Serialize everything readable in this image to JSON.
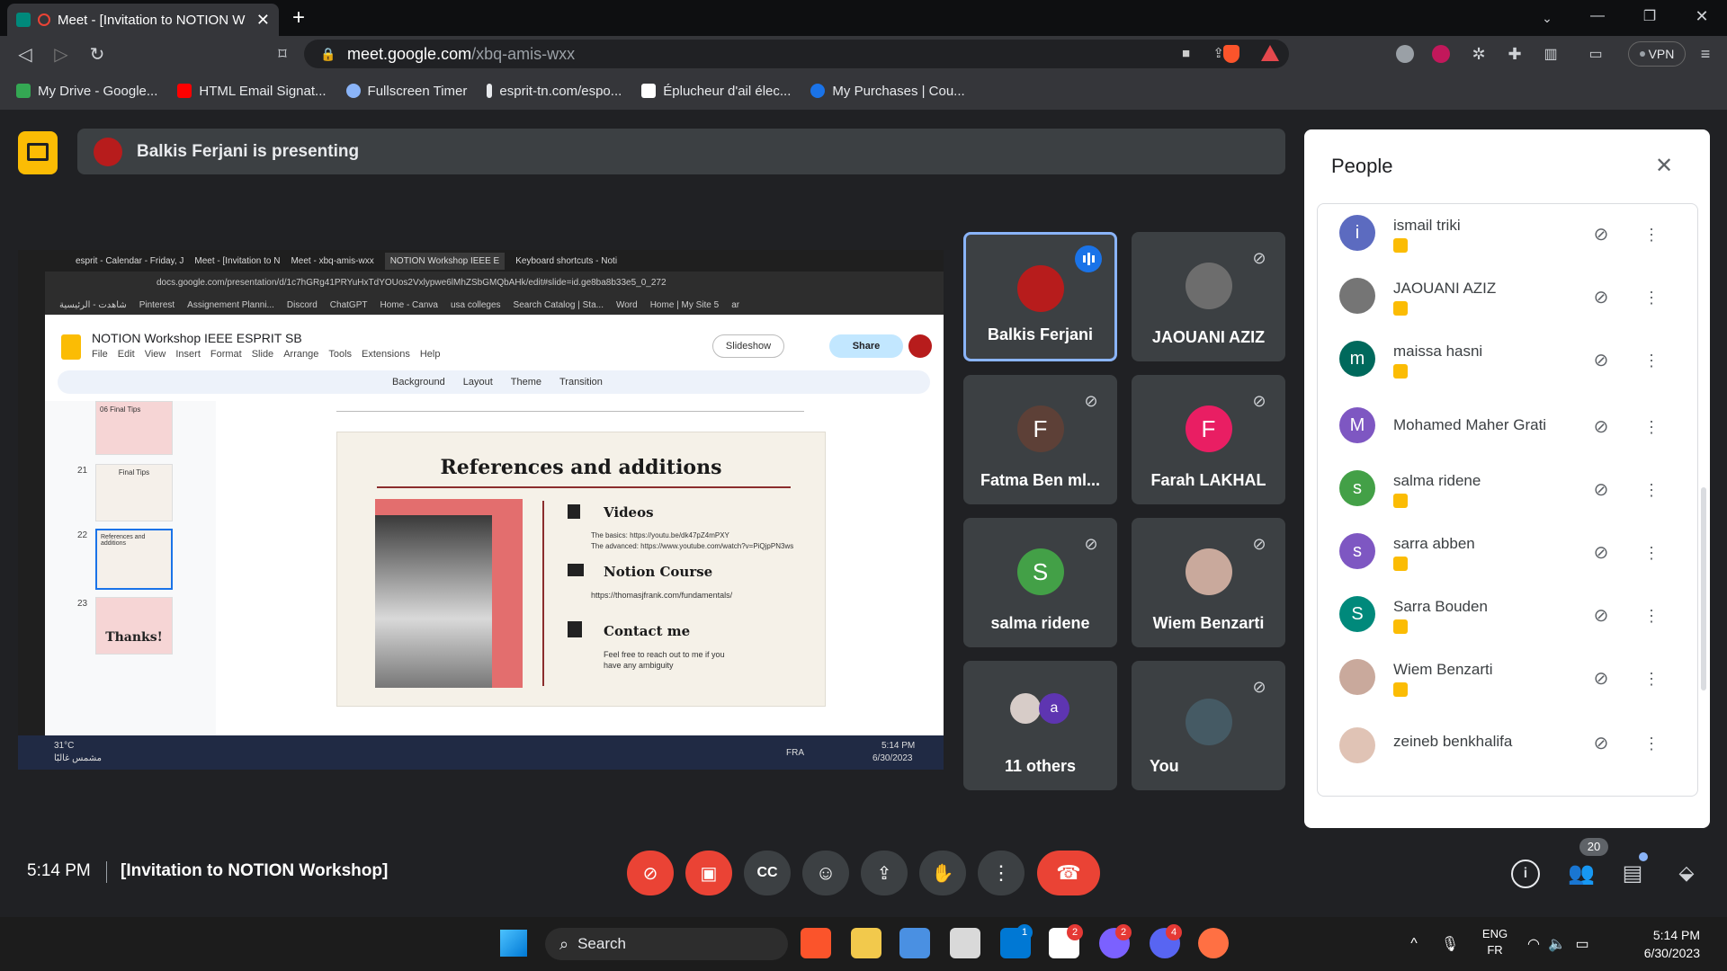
{
  "browser": {
    "tab_title": "Meet - [Invitation to NOTION W",
    "url_domain": "meet.google.com",
    "url_path": "/xbq-amis-wxx",
    "vpn_label": "VPN",
    "bookmarks": [
      {
        "label": "My Drive - Google...",
        "color": "#34a853"
      },
      {
        "label": "HTML Email Signat...",
        "color": "#ff0000"
      },
      {
        "label": "Fullscreen Timer",
        "color": "#8ab4f8"
      },
      {
        "label": "esprit-tn.com/espo...",
        "color": "#e8eaed"
      },
      {
        "label": "Éplucheur d'ail élec...",
        "color": "#ffffff"
      },
      {
        "label": "My Purchases | Cou...",
        "color": "#1a73e8"
      }
    ]
  },
  "meet": {
    "presenting_text": "Balkis Ferjani is presenting",
    "meeting_time": "5:14 PM",
    "meeting_title": "[Invitation to NOTION Workshop]",
    "participant_count": "20",
    "tiles": [
      {
        "name": "Balkis Ferjani",
        "initial": "",
        "color": "#b71c1c",
        "speaking": true
      },
      {
        "name": "JAOUANI AZIZ",
        "initial": "",
        "color": "#6d6d6d",
        "speaking": false
      },
      {
        "name": "Fatma Ben ml...",
        "initial": "F",
        "color": "#5d4037",
        "speaking": false
      },
      {
        "name": "Farah LAKHAL",
        "initial": "F",
        "color": "#e91e63",
        "speaking": false
      },
      {
        "name": "salma ridene",
        "initial": "S",
        "color": "#43a047",
        "speaking": false
      },
      {
        "name": "Wiem Benzarti",
        "initial": "",
        "color": "#c9a99c",
        "speaking": false
      },
      {
        "name": "11 others",
        "initial": "a",
        "color": "#5e35b1",
        "speaking": false
      },
      {
        "name": "You",
        "initial": "",
        "color": "#455a64",
        "speaking": false
      }
    ]
  },
  "people_panel": {
    "title": "People",
    "participants": [
      {
        "name": "ismail triki",
        "initial": "i",
        "color": "#5c6bc0",
        "badge": true
      },
      {
        "name": "JAOUANI AZIZ",
        "initial": "",
        "color": "#757575",
        "badge": true
      },
      {
        "name": "maissa hasni",
        "initial": "m",
        "color": "#00695c",
        "badge": true
      },
      {
        "name": "Mohamed Maher Grati",
        "initial": "M",
        "color": "#7e57c2",
        "badge": false
      },
      {
        "name": "salma ridene",
        "initial": "s",
        "color": "#43a047",
        "badge": true
      },
      {
        "name": "sarra abben",
        "initial": "s",
        "color": "#7e57c2",
        "badge": true
      },
      {
        "name": "Sarra Bouden",
        "initial": "S",
        "color": "#00897b",
        "badge": true
      },
      {
        "name": "Wiem Benzarti",
        "initial": "",
        "color": "#c9a99c",
        "badge": true
      },
      {
        "name": "zeineb benkhalifa",
        "initial": "",
        "color": "#e0c3b5",
        "badge": false
      }
    ]
  },
  "shared_screen": {
    "tabs": [
      "esprit - Calendar - Friday, J",
      "Meet - [Invitation to N",
      "Meet - xbq-amis-wxx",
      "NOTION Workshop IEEE E",
      "Keyboard shortcuts - Noti"
    ],
    "url": "docs.google.com/presentation/d/1c7hGRg41PRYuHxTdYOUos2Vxlypwe6lMhZSbGMQbAHk/edit#slide=id.ge8ba8b33e5_0_272",
    "bookmarks": [
      "شاهدت - الرئيسية",
      "Pinterest",
      "Assignement Planni...",
      "Discord",
      "ChatGPT",
      "Home - Canva",
      "usa colleges",
      "Search Catalog | Sta...",
      "Word",
      "Home | My Site 5",
      "ar"
    ],
    "doc_title": "NOTION Workshop IEEE ESPRIT SB",
    "menu": [
      "File",
      "Edit",
      "View",
      "Insert",
      "Format",
      "Slide",
      "Arrange",
      "Tools",
      "Extensions",
      "Help"
    ],
    "slideshow": "Slideshow",
    "share": "Share",
    "format_bar": [
      "Background",
      "Layout",
      "Theme",
      "Transition"
    ],
    "thumbs": [
      {
        "num": "",
        "label": "06 Final Tips"
      },
      {
        "num": "21",
        "label": "Final Tips"
      },
      {
        "num": "22",
        "label": "References and additions"
      },
      {
        "num": "23",
        "label": "Thanks!"
      }
    ],
    "slide": {
      "title": "References and additions",
      "sections": [
        {
          "heading": "Videos",
          "lines": [
            "The basics: https://youtu.be/dk47pZ4mPXY",
            "The advanced: https://www.youtube.com/watch?v=PiQjpPN3ws"
          ]
        },
        {
          "heading": "Notion Course",
          "lines": [
            "https://thomasjfrank.com/fundamentals/"
          ]
        },
        {
          "heading": "Contact me",
          "lines": [
            "Feel free to reach out to me if you",
            "have any ambiguity"
          ]
        }
      ]
    },
    "taskbar": {
      "weather": "31°C",
      "weather_sub": "مشمس غالبًا",
      "lang": "FRA",
      "time": "5:14 PM",
      "date": "6/30/2023"
    }
  },
  "taskbar": {
    "search": "Search",
    "lang_top": "ENG",
    "lang_bottom": "FR",
    "time": "5:14 PM",
    "date": "6/30/2023",
    "badges": [
      "1",
      "2",
      "2",
      "4"
    ]
  }
}
